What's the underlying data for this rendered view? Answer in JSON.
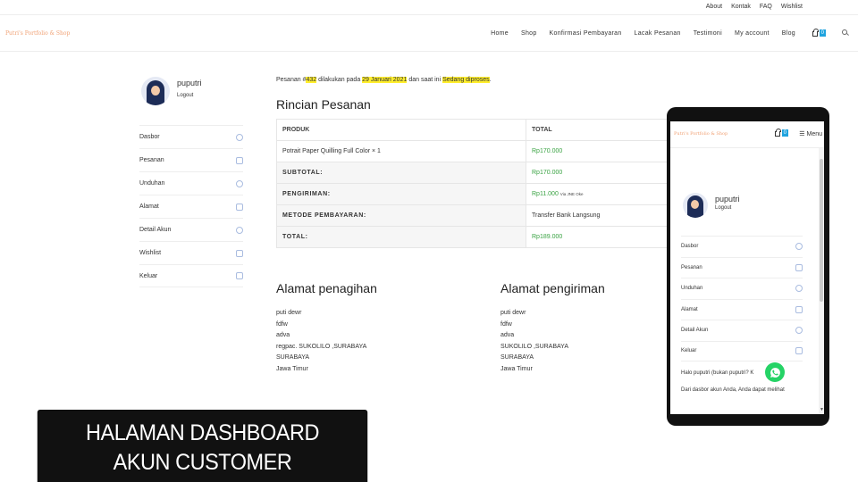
{
  "topbar": {
    "links": [
      "About",
      "Kontak",
      "FAQ",
      "Wishlist"
    ]
  },
  "header": {
    "brand": "Putri's Portfolio & Shop",
    "menu": [
      "Home",
      "Shop",
      "Konfirmasi Pembayaran",
      "Lacak Pesanan",
      "Testimoni",
      "My account",
      "Blog"
    ],
    "cart_count": "0"
  },
  "account": {
    "username": "puputri",
    "logout": "Logout"
  },
  "sidebar": [
    {
      "label": "Dasbor",
      "icon": "dashboard-icon"
    },
    {
      "label": "Pesanan",
      "icon": "cart-icon"
    },
    {
      "label": "Unduhan",
      "icon": "cloud-download-icon"
    },
    {
      "label": "Alamat",
      "icon": "home-icon"
    },
    {
      "label": "Detail Akun",
      "icon": "user-icon"
    },
    {
      "label": "Wishlist",
      "icon": "document-icon"
    },
    {
      "label": "Keluar",
      "icon": "logout-icon"
    }
  ],
  "order": {
    "notice_pre": "Pesanan #",
    "number": "432",
    "notice_mid": " dilakukan pada ",
    "date": "29 Januari 2021",
    "notice_mid2": " dan saat ini ",
    "status": "Sedang diproses",
    "notice_end": ".",
    "title": "Rincian Pesanan",
    "col_product": "PRODUK",
    "col_total": "TOTAL",
    "product": "Potrait Paper Quilling Full Color × 1",
    "product_total": "Rp170.000",
    "subtotal_label": "SUBTOTAL:",
    "subtotal": "Rp170.000",
    "shipping_label": "PENGIRIMAN:",
    "shipping": "Rp11.000",
    "shipping_via": "Via JNE Oke",
    "payment_label": "METODE PEMBAYARAN:",
    "payment": "Transfer Bank Langsung",
    "total_label": "TOTAL:",
    "total": "Rp189.000"
  },
  "billing": {
    "title": "Alamat penagihan",
    "lines": [
      "puti dewr",
      "fdfw",
      "adva",
      "regpac. SUKOLILO ,SURABAYA",
      "SURABAYA",
      "Jawa Timur"
    ]
  },
  "shipping_address": {
    "title": "Alamat pengiriman",
    "lines": [
      "puti dewr",
      "fdfw",
      "adva",
      "SUKOLILO ,SURABAYA",
      "SURABAYA",
      "Jawa Timur"
    ]
  },
  "phone": {
    "brand": "Putri's Portfolio & Shop",
    "cart_count": "0",
    "menu": "Menu",
    "username": "puputri",
    "logout": "Logout",
    "sidebar": [
      "Dasbor",
      "Pesanan",
      "Unduhan",
      "Alamat",
      "Detail Akun",
      "Keluar"
    ],
    "hello": "Halo puputri (bukan puputri? K",
    "desc": "Dari dasbor akun Anda, Anda dapat melihat"
  },
  "banner": {
    "line1": "HALAMAN DASHBOARD",
    "line2": "AKUN CUSTOMER"
  },
  "colors": {
    "accent": "#1fa3de",
    "brand": "#f0a073",
    "price": "#3aa343",
    "highlight": "#ffee2d"
  }
}
